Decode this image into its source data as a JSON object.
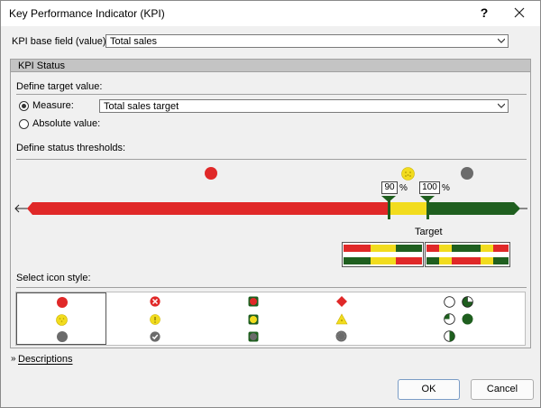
{
  "title": "Key Performance Indicator (KPI)",
  "help_glyph": "?",
  "base_field": {
    "label": "KPI base field (value):",
    "value": "Total sales"
  },
  "status_section": {
    "label": "KPI Status"
  },
  "target": {
    "label": "Define target value:",
    "measure_label": "Measure:",
    "measure_value": "Total sales target",
    "absolute_label": "Absolute value:",
    "selected": "measure"
  },
  "thresholds": {
    "label": "Define status thresholds:",
    "low_value": "90",
    "high_value": "100",
    "pct": "%",
    "target_label": "Target"
  },
  "icon_style": {
    "label": "Select icon style:"
  },
  "descriptions": {
    "label": "Descriptions",
    "glyph": "»"
  },
  "buttons": {
    "ok": "OK",
    "cancel": "Cancel"
  },
  "colors": {
    "red": "#e02828",
    "yellow": "#f2dc1e",
    "green": "#1f5f1f",
    "gray": "#6b6b6b"
  }
}
